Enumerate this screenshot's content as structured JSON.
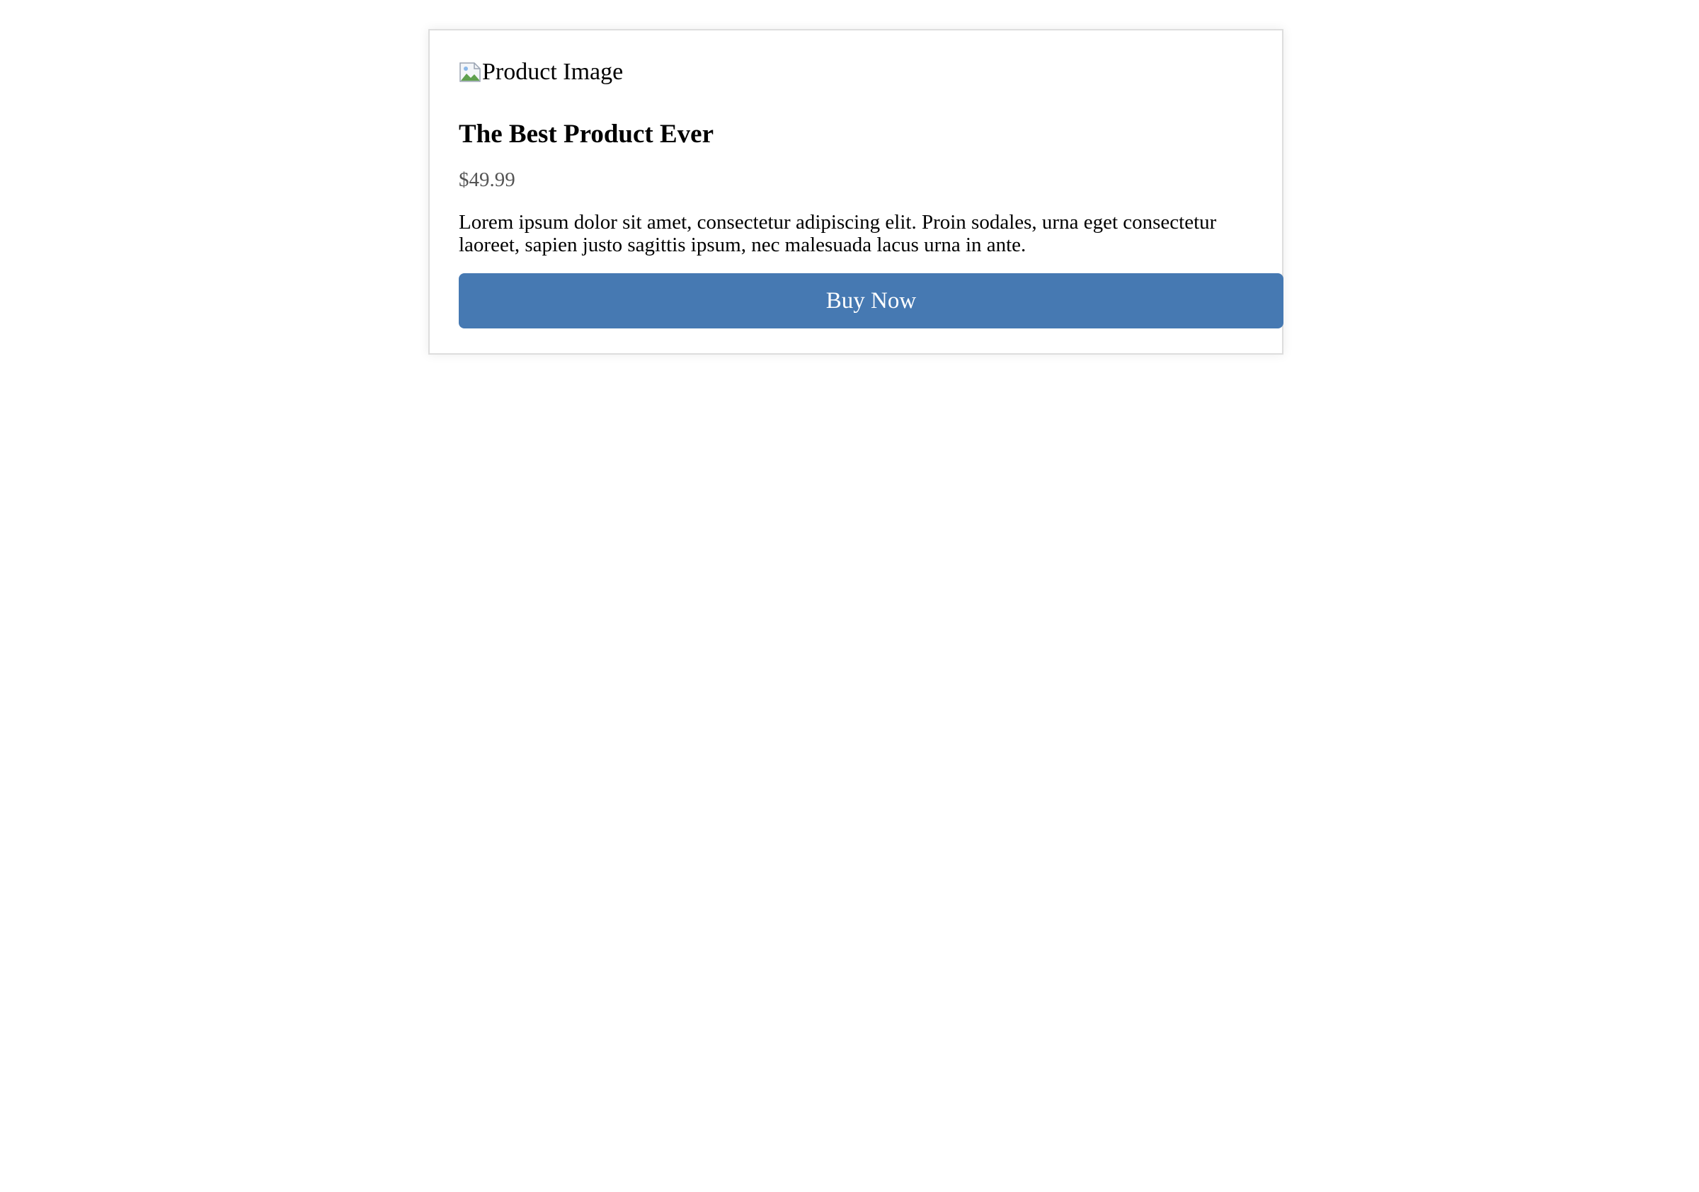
{
  "product": {
    "image_alt": "Product Image",
    "title": "The Best Product Ever",
    "price": "$49.99",
    "description": "Lorem ipsum dolor sit amet, consectetur adipiscing elit. Proin sodales, urna eget consectetur laoreet, sapien justo sagittis ipsum, nec malesuada lacus urna in ante.",
    "buy_label": "Buy Now"
  },
  "icons": {
    "product_image": "broken-image-icon"
  },
  "colors": {
    "button_bg": "#4679b2",
    "button_text": "#ffffff",
    "price_text": "#555555",
    "card_border": "#dddddd"
  }
}
